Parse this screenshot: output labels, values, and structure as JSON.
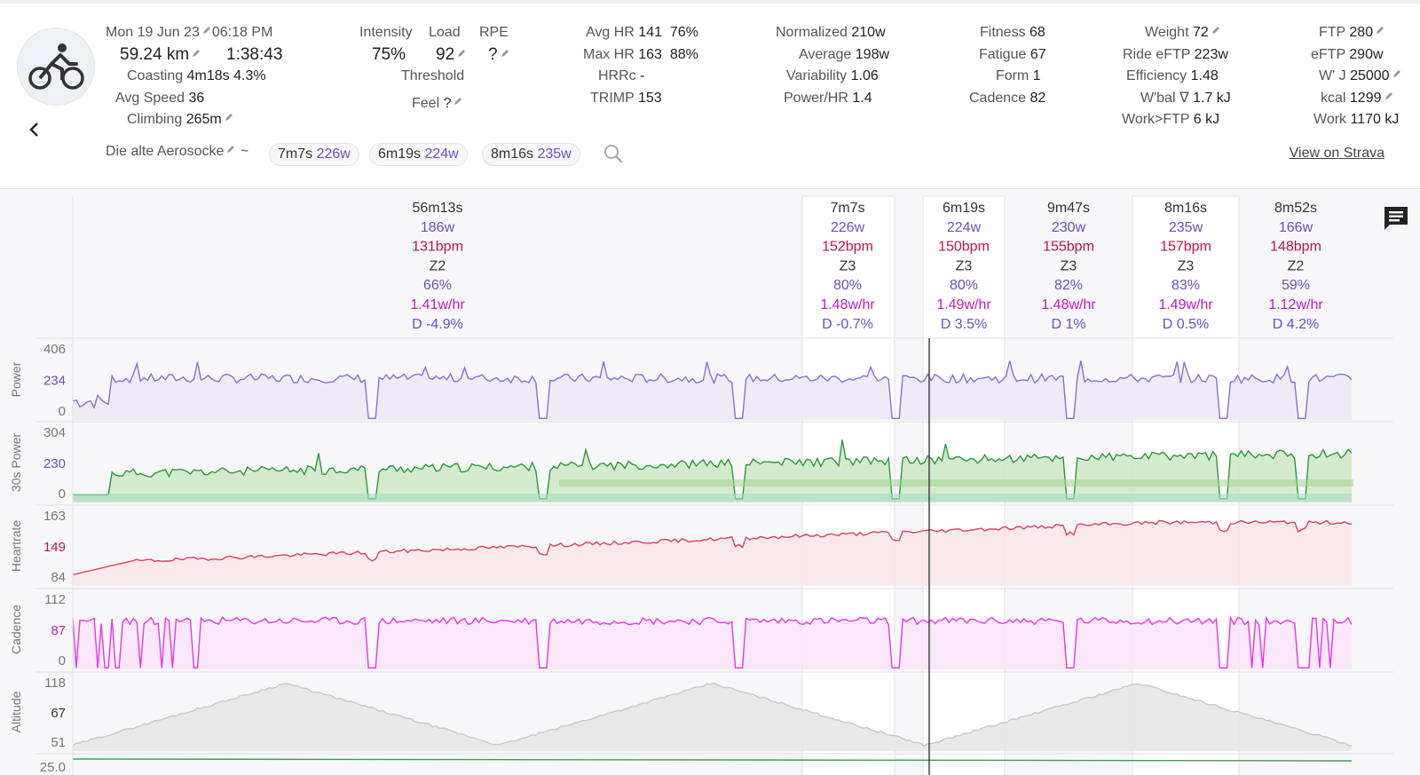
{
  "activity": {
    "date": "Mon 19 Jun 23",
    "time": "06:18 PM",
    "distance": "59.24 km",
    "duration": "1:38:43",
    "coasting_label": "Coasting",
    "coasting_time": "4m18s",
    "coasting_pct": "4.3%",
    "avgspeed_label": "Avg Speed",
    "avgspeed_value": "36",
    "climbing_label": "Climbing",
    "climbing_value": "265m",
    "name": "Die alte Aerosocke",
    "name_sep": "~"
  },
  "intensity": {
    "intensity_label": "Intensity",
    "intensity_value": "75%",
    "load_label": "Load",
    "load_value": "92",
    "rpe_label": "RPE",
    "rpe_value": "?",
    "threshold_label": "Threshold",
    "feel_label": "Feel",
    "feel_value": "?"
  },
  "hr": {
    "avg_label": "Avg HR",
    "avg_value": "141",
    "avg_pct": "76%",
    "max_label": "Max HR",
    "max_value": "163",
    "max_pct": "88%",
    "hrrc_label": "HRRc",
    "hrrc_value": "-",
    "trimp_label": "TRIMP",
    "trimp_value": "153"
  },
  "power": {
    "normalized_label": "Normalized",
    "normalized_value": "210w",
    "average_label": "Average",
    "average_value": "198w",
    "variability_label": "Variability",
    "variability_value": "1.06",
    "powerhr_label": "Power/HR",
    "powerhr_value": "1.4"
  },
  "fitness": {
    "fitness_label": "Fitness",
    "fitness_value": "68",
    "fatigue_label": "Fatigue",
    "fatigue_value": "67",
    "form_label": "Form",
    "form_value": "1",
    "cadence_label": "Cadence",
    "cadence_value": "82"
  },
  "weight": {
    "weight_label": "Weight",
    "weight_value": "72",
    "rideeftp_label": "Ride eFTP",
    "rideeftp_value": "223w",
    "efficiency_label": "Efficiency",
    "efficiency_value": "1.48",
    "wbal_label": "W'bal ∇",
    "wbal_value": "1.7 kJ",
    "workftp_label": "Work>FTP",
    "workftp_value": "6 kJ"
  },
  "ftp": {
    "ftp_label": "FTP",
    "ftp_value": "280",
    "eftp_label": "eFTP",
    "eftp_value": "290w",
    "wj_label": "W' J",
    "wj_value": "25000",
    "kcal_label": "kcal",
    "kcal_value": "1299",
    "work_label": "Work",
    "work_value": "1170 kJ"
  },
  "chips": [
    {
      "time": "7m7s",
      "watts": "226w"
    },
    {
      "time": "6m19s",
      "watts": "224w"
    },
    {
      "time": "8m16s",
      "watts": "235w"
    }
  ],
  "strava_link": "View on Strava",
  "intervals": [
    {
      "time": "56m13s",
      "watts": "186w",
      "bpm": "131bpm",
      "zone": "Z2",
      "pct": "66%",
      "whr": "1.41w/hr",
      "drift": "D -4.9%"
    },
    {
      "time": "7m7s",
      "watts": "226w",
      "bpm": "152bpm",
      "zone": "Z3",
      "pct": "80%",
      "whr": "1.48w/hr",
      "drift": "D -0.7%"
    },
    {
      "time": "6m19s",
      "watts": "224w",
      "bpm": "150bpm",
      "zone": "Z3",
      "pct": "80%",
      "whr": "1.49w/hr",
      "drift": "D 3.5%"
    },
    {
      "time": "9m47s",
      "watts": "230w",
      "bpm": "155bpm",
      "zone": "Z3",
      "pct": "82%",
      "whr": "1.48w/hr",
      "drift": "D 1%"
    },
    {
      "time": "8m16s",
      "watts": "235w",
      "bpm": "157bpm",
      "zone": "Z3",
      "pct": "83%",
      "whr": "1.49w/hr",
      "drift": "D 0.5%"
    },
    {
      "time": "8m52s",
      "watts": "166w",
      "bpm": "148bpm",
      "zone": "Z2",
      "pct": "59%",
      "whr": "1.12w/hr",
      "drift": "D 4.2%"
    }
  ],
  "panels": [
    {
      "name": "Power",
      "ticks": [
        "406",
        "234",
        "0"
      ],
      "mid_color": "#6a4fc8",
      "line_color": "#8a6fd6"
    },
    {
      "name": "30s Power",
      "ticks": [
        "304",
        "230",
        "0"
      ],
      "mid_color": "#6a4fc8",
      "line_color": "#2a9a3a"
    },
    {
      "name": "Heartrate",
      "ticks": [
        "163",
        "149",
        "84"
      ],
      "mid_color": "#c0144a",
      "line_color": "#e0405a"
    },
    {
      "name": "Cadence",
      "ticks": [
        "112",
        "87",
        "0"
      ],
      "mid_color": "#c018c0",
      "line_color": "#f030f0"
    },
    {
      "name": "Altitude",
      "ticks": [
        "118",
        "67",
        "51"
      ],
      "mid_color": "#333333",
      "line_color": "#c8c8c8"
    }
  ],
  "bottom_tick": "25.0",
  "colors": {
    "watts": "#6a4fc8",
    "bpm": "#c0144a",
    "whr": "#c018c0",
    "drift": "#6a4fc8"
  }
}
